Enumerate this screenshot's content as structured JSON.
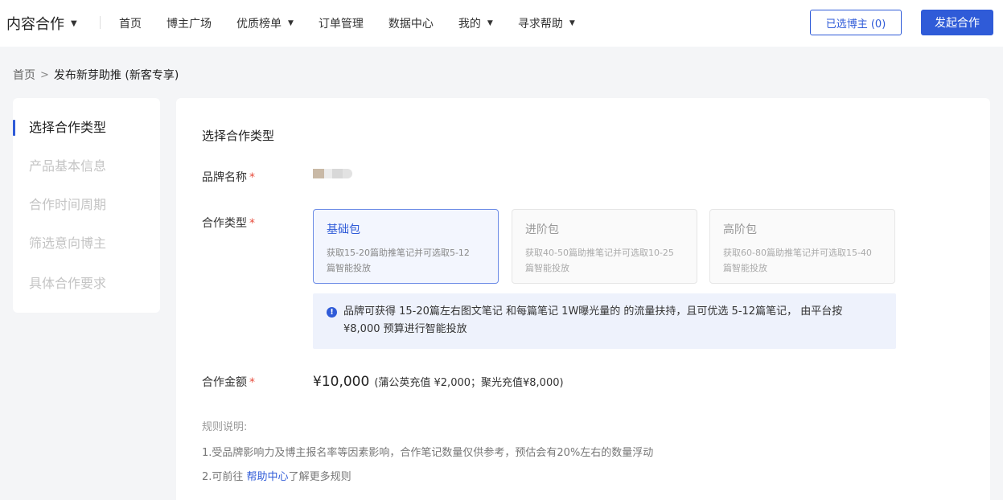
{
  "header": {
    "brand": "内容合作",
    "nav": [
      "首页",
      "博主广场",
      "优质榜单",
      "订单管理",
      "数据中心",
      "我的",
      "寻求帮助"
    ],
    "selected_button": "已选博主 (0)",
    "primary_button": "发起合作"
  },
  "breadcrumb": {
    "home": "首页",
    "current": "发布新芽助推 (新客专享)"
  },
  "sidebar": {
    "items": [
      "选择合作类型",
      "产品基本信息",
      "合作时间周期",
      "筛选意向博主",
      "具体合作要求"
    ]
  },
  "form": {
    "section_title": "选择合作类型",
    "brand_label": "品牌名称",
    "type_label": "合作类型",
    "required_mark": "*",
    "packages": [
      {
        "name": "基础包",
        "desc1": "获取15-20篇助推笔记并可选取5-12",
        "desc2": "篇智能投放"
      },
      {
        "name": "进阶包",
        "desc1": "获取40-50篇助推笔记并可选取10-25",
        "desc2": "篇智能投放"
      },
      {
        "name": "高阶包",
        "desc1": "获取60-80篇助推笔记并可选取15-40",
        "desc2": "篇智能投放"
      }
    ],
    "notice_line1": "品牌可获得 15-20篇左右图文笔记 和每篇笔记 1W曝光量的 的流量扶持，且可优选 5-12篇笔记， 由平台按",
    "notice_line2": "¥8,000 预算进行智能投放",
    "amount_label": "合作金额",
    "amount_value": "¥10,000",
    "amount_detail": "(蒲公英充值 ¥2,000；聚光充值¥8,000)"
  },
  "rules": {
    "title": "规则说明:",
    "rule1": "1.受品牌影响力及博主报名率等因素影响，合作笔记数量仅供参考，预估会有20%左右的数量浮动",
    "rule2_prefix": "2.可前往",
    "rule2_link": "帮助中心",
    "rule2_suffix": "了解更多规则"
  }
}
